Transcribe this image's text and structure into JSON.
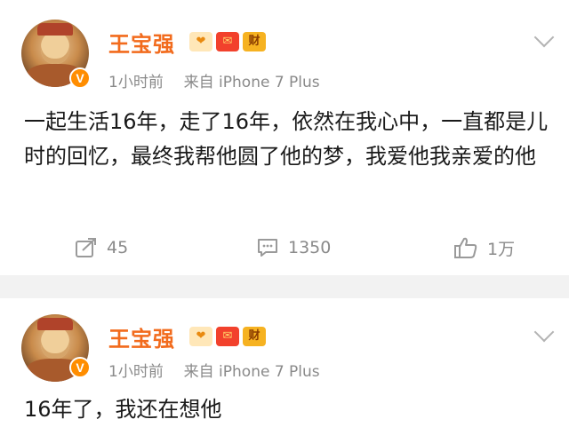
{
  "posts": [
    {
      "author": "王宝强",
      "badges": [
        {
          "icon": "heart-hand-icon",
          "text": "❤"
        },
        {
          "icon": "red-envelope-icon",
          "text": "✉"
        },
        {
          "icon": "cai-badge-icon",
          "text": "财"
        }
      ],
      "verified_mark": "V",
      "time": "1小时前",
      "source": "来自 iPhone 7 Plus",
      "text": "一起生活16年，走了16年，依然在我心中，一直都是儿时的回忆，最终我帮他圆了他的梦，我爱他我亲爱的他",
      "actions": {
        "repost_count": "45",
        "comment_count": "1350",
        "like_count": "1万"
      }
    },
    {
      "author": "王宝强",
      "badges": [
        {
          "icon": "heart-hand-icon",
          "text": "❤"
        },
        {
          "icon": "red-envelope-icon",
          "text": "✉"
        },
        {
          "icon": "cai-badge-icon",
          "text": "财"
        }
      ],
      "verified_mark": "V",
      "time": "1小时前",
      "source": "来自 iPhone 7 Plus",
      "text": "16年了，我还在想他"
    }
  ],
  "colors": {
    "author_name": "#f26b1d",
    "meta_text": "#8a8a8a",
    "divider": "#f2f2f2",
    "verified_badge": "#ff8d00"
  }
}
